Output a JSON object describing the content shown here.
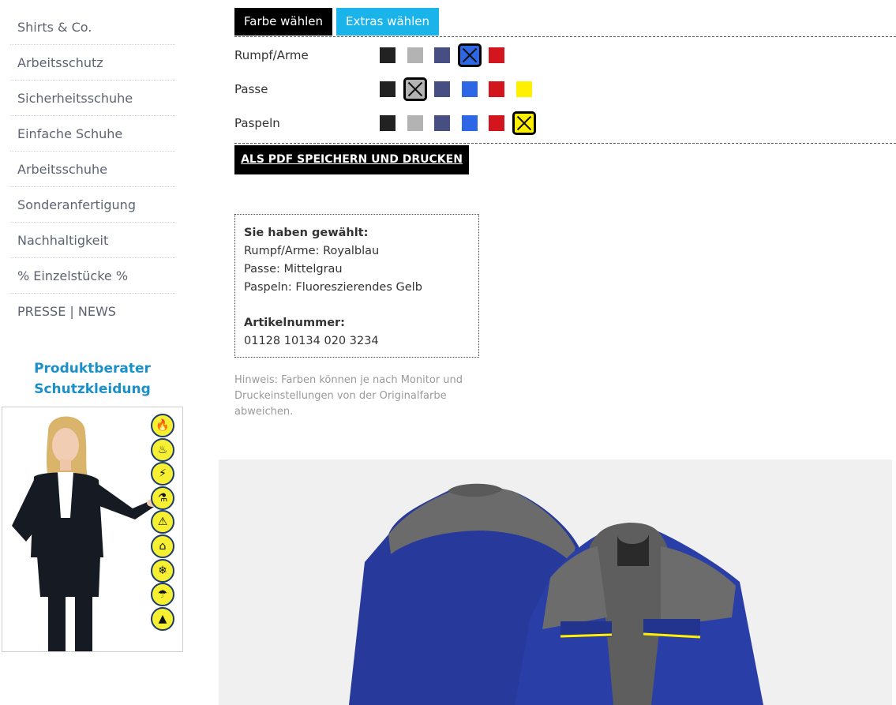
{
  "sidebar": {
    "items": [
      {
        "label": "Shirts & Co."
      },
      {
        "label": "Arbeitsschutz"
      },
      {
        "label": "Sicherheitsschuhe"
      },
      {
        "label": "Einfache Schuhe"
      },
      {
        "label": "Arbeitsschuhe"
      },
      {
        "label": "Sonderanfertigung"
      },
      {
        "label": "Nachhaltigkeit"
      },
      {
        "label": "% Einzelstücke %"
      },
      {
        "label": "PRESSE | NEWS"
      }
    ],
    "advisor_title_line1": "Produktberater",
    "advisor_title_line2": "Schutzkleidung",
    "hazard_icons": [
      "flame-icon",
      "heat-icon",
      "electric-arc-icon",
      "chemical-icon",
      "warning-icon",
      "antistatic-icon",
      "cold-icon",
      "rain-icon",
      "esd-icon"
    ]
  },
  "tabs": {
    "color_tab": "Farbe wählen",
    "extras_tab": "Extras wählen"
  },
  "colors": {
    "black": "#222222",
    "grey": "#b3b3b3",
    "navy": "#464e82",
    "royal_blue": "#2e67e6",
    "red": "#d3161e",
    "yellow": "#ffef00",
    "tab_blue": "#1ab3ea",
    "advisor_blue": "#1a90c9"
  },
  "configurator": {
    "rows": [
      {
        "label": "Rumpf/Arme"
      },
      {
        "label": "Passe"
      },
      {
        "label": "Paspeln"
      }
    ]
  },
  "pdf_button": "ALS PDF SPEICHERN UND DRUCKEN",
  "summary": {
    "heading": "Sie haben gewählt:",
    "line1": "Rumpf/Arme: Royalblau",
    "line2": "Passe: Mittelgrau",
    "line3": "Paspeln: Fluoreszierendes Gelb",
    "article_heading": "Artikelnummer:",
    "article_number": "01128 10134 020 3234"
  },
  "hint": "Hinweis: Farben können je nach Monitor und Druckeinstellungen von der Originalfarbe abweichen."
}
